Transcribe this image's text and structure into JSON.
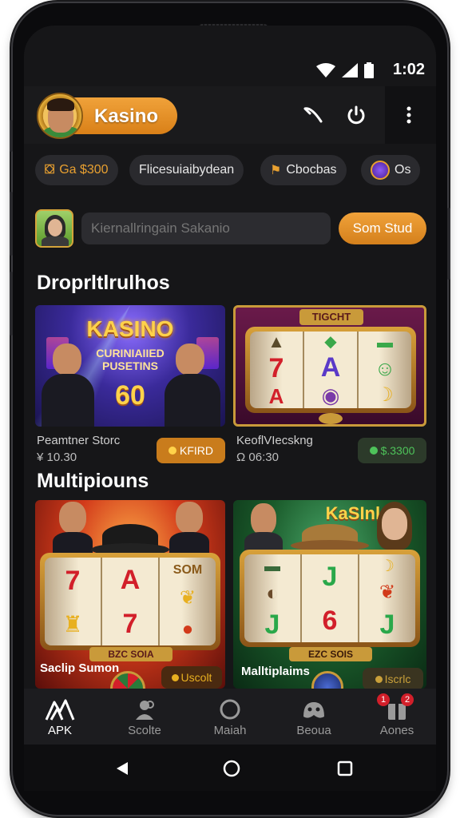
{
  "status": {
    "time": "1:02"
  },
  "header": {
    "logo_label": "Kasino"
  },
  "chips": [
    {
      "label": "Ga $300"
    },
    {
      "label": "Flicesuiaibydean"
    },
    {
      "label": "Cbocbas"
    },
    {
      "label": "Os"
    }
  ],
  "search": {
    "placeholder": "Kiernallringain Sakanio",
    "button_label": "Som Stud"
  },
  "sections": [
    {
      "title": "Droprltlrulhos"
    },
    {
      "title": "Multipiouns"
    }
  ],
  "cards": [
    {
      "banner_title": "KASINO",
      "banner_sub1": "CURINIAIIED",
      "banner_sub2": "PUSETINS",
      "banner_num": "60",
      "name": "Peamtner Storc",
      "meta": "¥ 10.30",
      "button": "KFIRD"
    },
    {
      "banner_title": "TIGCHT",
      "name": "KeoflVIecskng",
      "meta": "Ω 06:30",
      "button": "$.3300"
    },
    {
      "banner_title": "SOM",
      "plaque": "BZC SOIA",
      "name": "Saclip Sumon",
      "button": "Uscolt"
    },
    {
      "banner_title": "KaSInls",
      "plaque": "EZC SOIS",
      "name": "Malltiplaims",
      "button": "Iscrlc"
    }
  ],
  "bottom_nav": [
    {
      "label": "APK"
    },
    {
      "label": "Scolte"
    },
    {
      "label": "Maiah"
    },
    {
      "label": "Beoua"
    },
    {
      "label": "Aones",
      "badge_left": "1",
      "badge_right": "2"
    }
  ],
  "colors": {
    "accent": "#e8952a",
    "bg": "#161618",
    "chip": "#2a2a2e",
    "green": "#4ec35a"
  }
}
